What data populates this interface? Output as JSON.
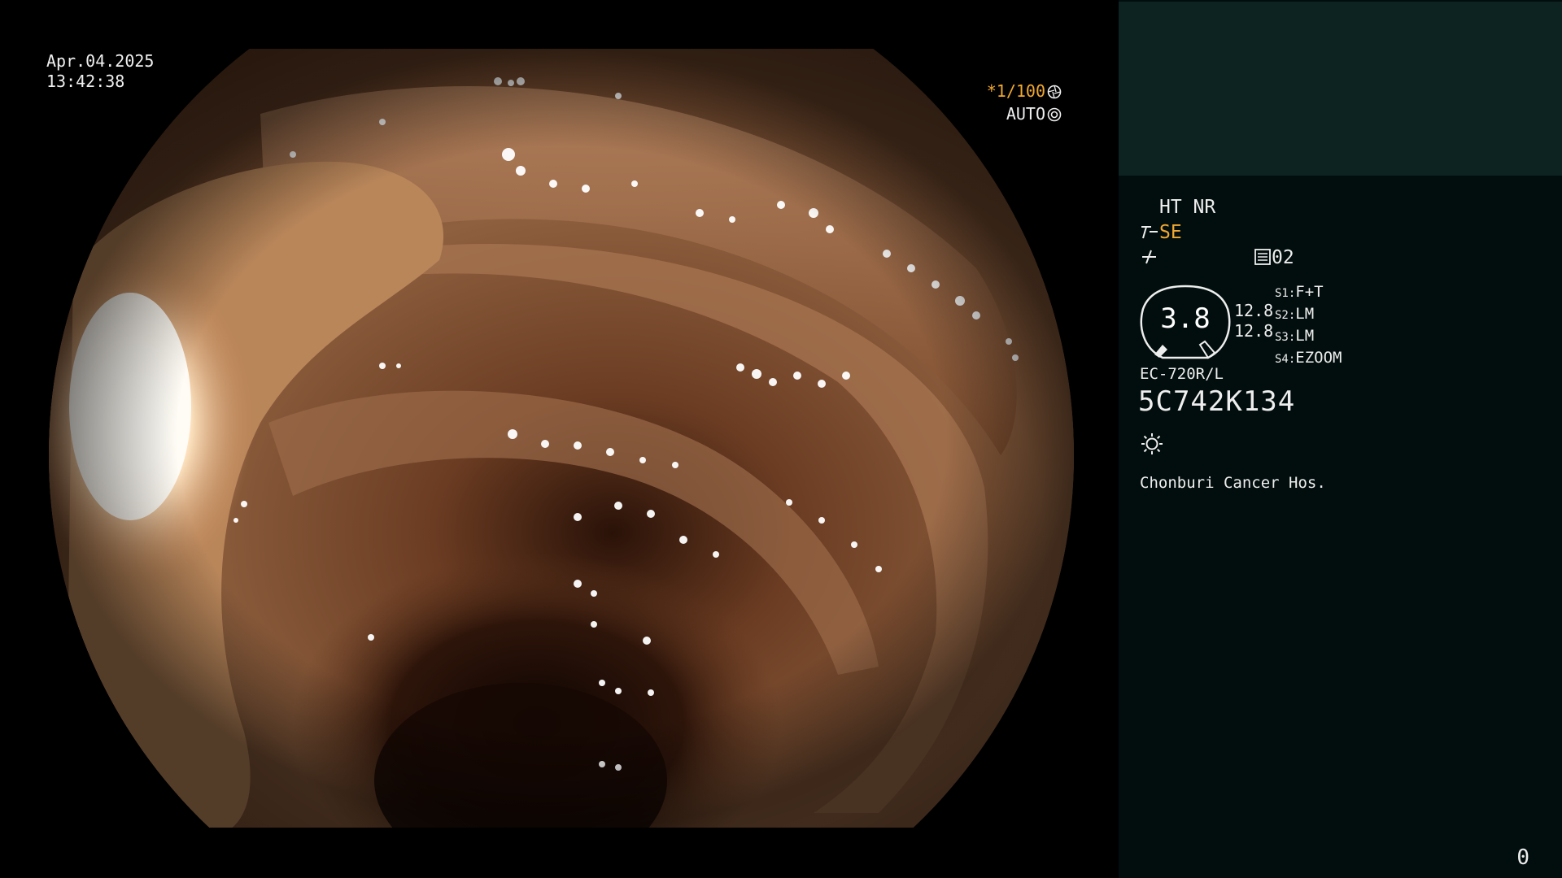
{
  "screen": {
    "date": "Apr.04.2025",
    "time": "13:42:38",
    "shutter_label": "*1/100",
    "iris_label": "AUTO"
  },
  "panel": {
    "ht_nr": "HT NR",
    "enhancement": "SE",
    "channel": "02",
    "gauge_value": "3.8",
    "value_top": "12.8",
    "value_bottom": "12.8",
    "slots": [
      {
        "key": "S1:",
        "value": "F+T"
      },
      {
        "key": "S2:",
        "value": "LM"
      },
      {
        "key": "S3:",
        "value": "LM"
      },
      {
        "key": "S4:",
        "value": "EZOOM"
      }
    ],
    "model": "EC-720R/L",
    "serial": "5C742K134",
    "hospital": "Chonburi Cancer Hos.",
    "counter": "0"
  },
  "colors": {
    "panel_bg": "#020e0d",
    "panel_top_bg": "#0d2322",
    "accent_amber": "#f0a830",
    "mucosa": "#8a5a3a"
  },
  "icons": [
    "shutter-icon",
    "iris-icon",
    "angle-icon",
    "wave-icon",
    "memory-icon",
    "light-icon"
  ]
}
